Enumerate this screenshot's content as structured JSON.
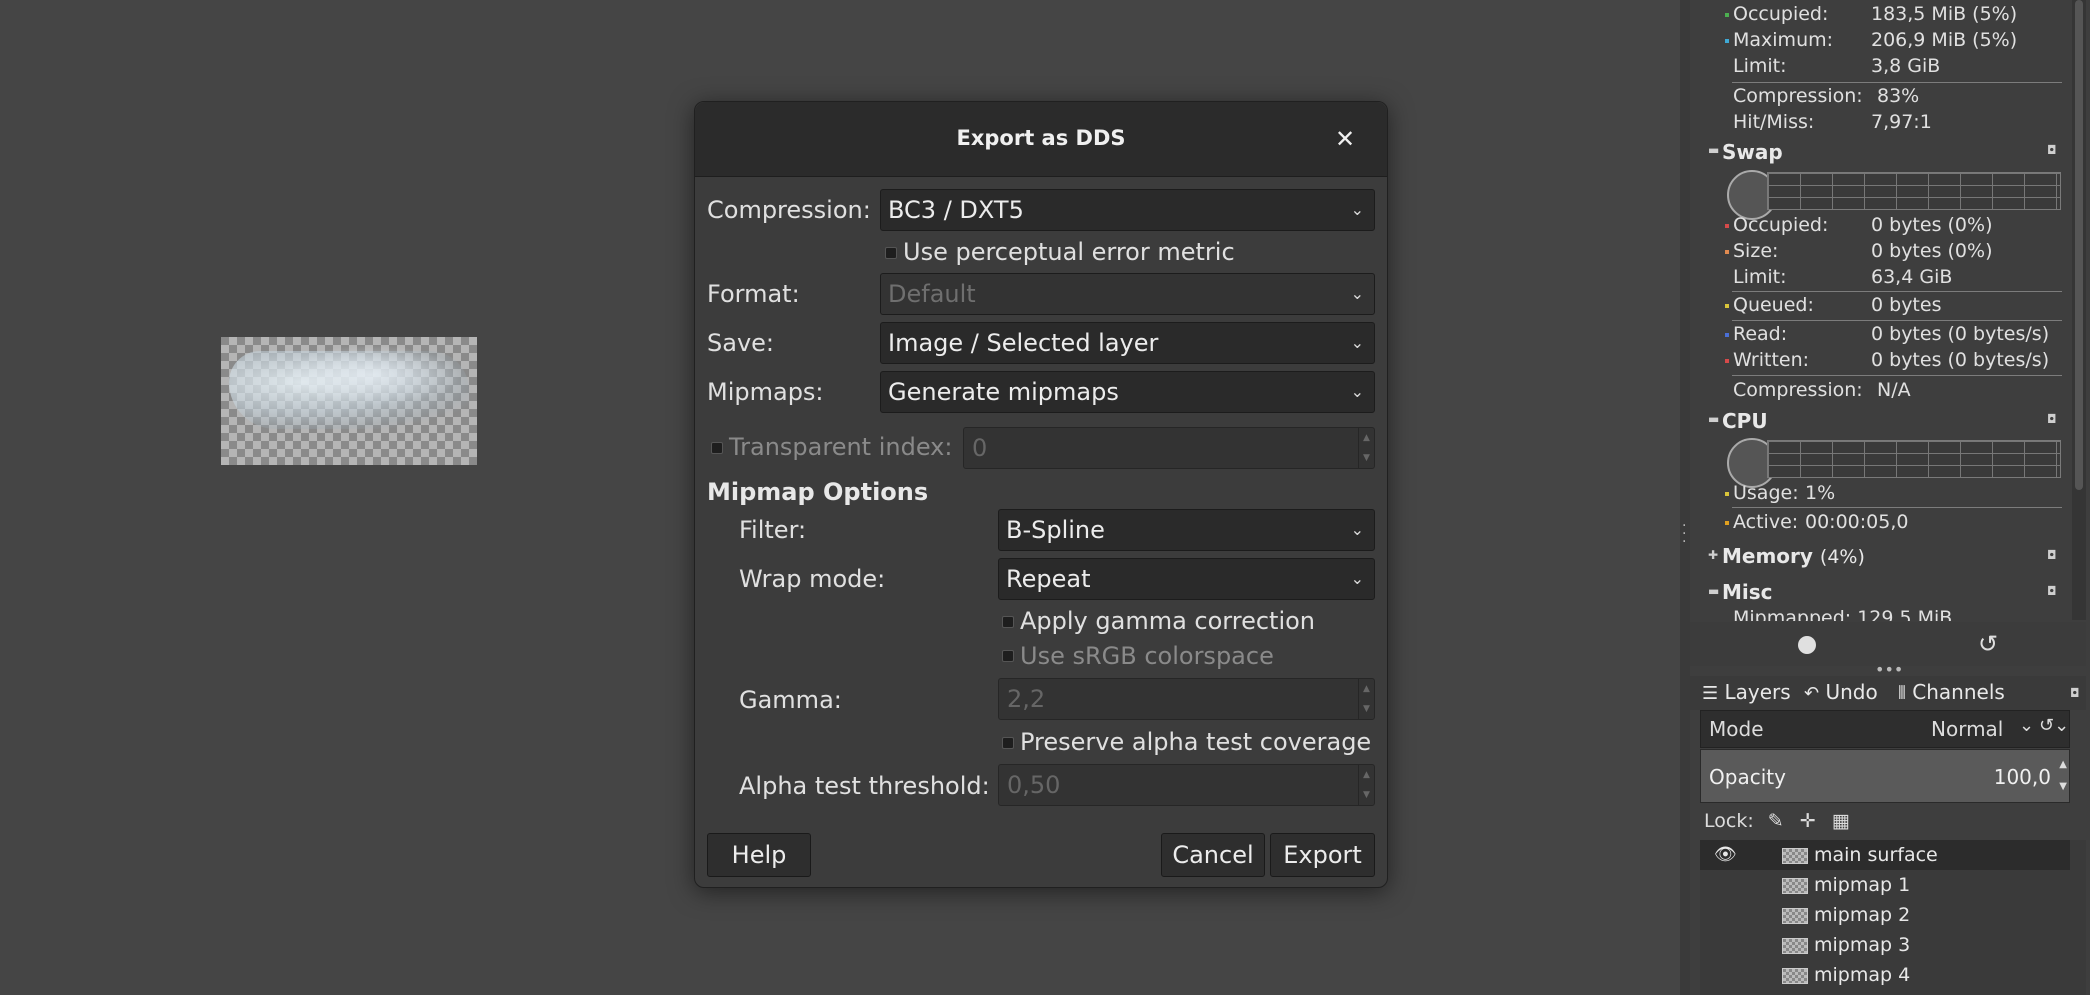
{
  "dialog": {
    "title": "Export as DDS",
    "close_glyph": "✕",
    "compression_label": "Compression:",
    "compression_value": "BC3 / DXT5",
    "perceptual_label": "Use perceptual error metric",
    "format_label": "Format:",
    "format_value": "Default",
    "save_label": "Save:",
    "save_value": "Image / Selected layer",
    "mipmaps_label": "Mipmaps:",
    "mipmaps_value": "Generate mipmaps",
    "transparent_label": "Transparent index:",
    "transparent_value": "0",
    "mipmap_options_heading": "Mipmap Options",
    "filter_label": "Filter:",
    "filter_value": "B-Spline",
    "wrap_label": "Wrap mode:",
    "wrap_value": "Repeat",
    "gamma_correction_label": "Apply gamma correction",
    "srgb_label": "Use sRGB colorspace",
    "gamma_label": "Gamma:",
    "gamma_value": "2,2",
    "preserve_alpha_label": "Preserve alpha test coverage",
    "alpha_threshold_label": "Alpha test threshold:",
    "alpha_threshold_value": "0,50",
    "help_button": "Help",
    "cancel_button": "Cancel",
    "export_button": "Export",
    "chevron": "⌄"
  },
  "dashboard": {
    "cache": [
      {
        "key": "Occupied:",
        "value": "183,5 MiB (5%)",
        "dot": "#4caf50"
      },
      {
        "key": "Maximum:",
        "value": "206,9 MiB (5%)",
        "dot": "#3fa9d5"
      },
      {
        "key": "Limit:",
        "value": "3,8 GiB",
        "dot": ""
      },
      {
        "key": "Compression:",
        "value": "83%",
        "dot": ""
      },
      {
        "key": "Hit/Miss:",
        "value": "7,97:1",
        "dot": ""
      }
    ],
    "swap_title": "Swap",
    "swap": [
      {
        "key": "Occupied:",
        "value": "0 bytes (0%)",
        "dot": "#d64a4a"
      },
      {
        "key": "Size:",
        "value": "0 bytes (0%)",
        "dot": "#e08a50"
      },
      {
        "key": "Limit:",
        "value": "63,4 GiB",
        "dot": ""
      },
      {
        "key": "Queued:",
        "value": "0 bytes",
        "dot": "#d9c53a"
      },
      {
        "key": "Read:",
        "value": "0 bytes (0 bytes/s)",
        "dot": "#4a6fd6"
      },
      {
        "key": "Written:",
        "value": "0 bytes (0 bytes/s)",
        "dot": "#d64a4a"
      },
      {
        "key": "Compression:",
        "value": "N/A",
        "dot": ""
      }
    ],
    "cpu_title": "CPU",
    "cpu": [
      {
        "key": "Usage:",
        "value": "1%",
        "dot": "#d9c53a"
      },
      {
        "key": "Active:",
        "value": "00:00:05,0",
        "dot": "#e0a020"
      }
    ],
    "memory_title": "Memory",
    "memory_value": "(4%)",
    "misc_title": "Misc",
    "misc_first": "Mipmapped: 129,5 MiB"
  },
  "layers_panel": {
    "tabs": [
      "Layers",
      "Undo",
      "Channels"
    ],
    "mode_label": "Mode",
    "mode_value": "Normal",
    "opacity_label": "Opacity",
    "opacity_value": "100,0",
    "lock_label": "Lock:",
    "layers": [
      "main surface",
      "mipmap 1",
      "mipmap 2",
      "mipmap 3",
      "mipmap 4"
    ]
  }
}
